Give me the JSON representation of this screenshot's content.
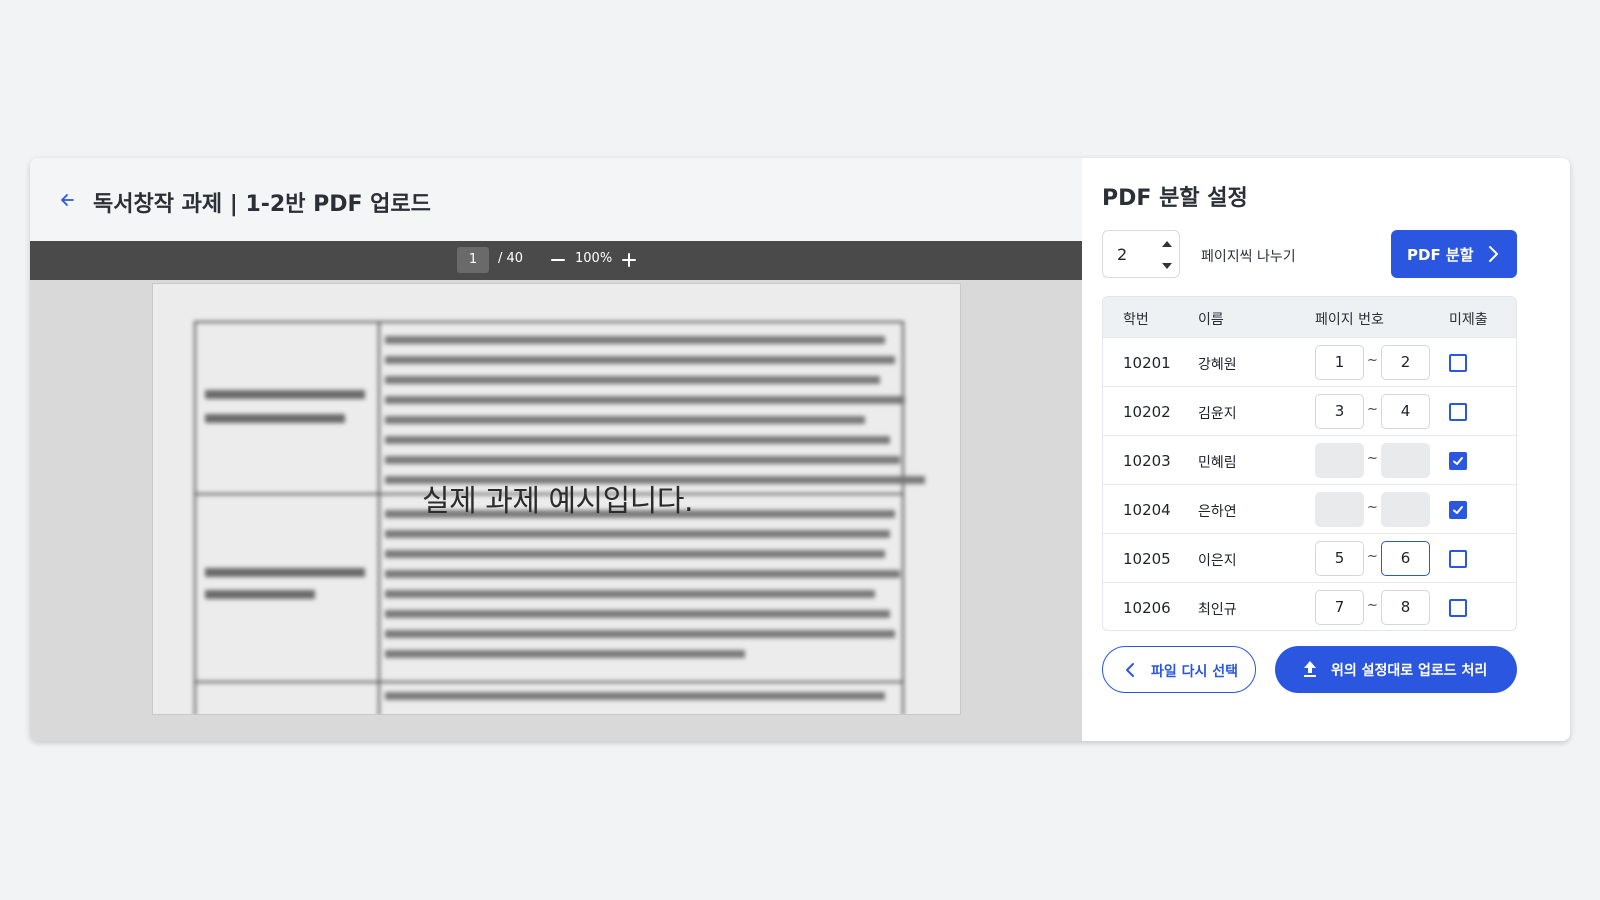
{
  "header": {
    "title": "독서창작 과제 | 1-2반 PDF 업로드"
  },
  "viewer": {
    "current_page": "1",
    "total_pages": "/ 40",
    "zoom": "100%",
    "overlay_text": "실제 과제 예시입니다."
  },
  "panel": {
    "title": "PDF 분할 설정",
    "pages_per_split": "2",
    "pages_per_split_label": "페이지씩 나누기",
    "split_button": "PDF 분할",
    "columns": {
      "student_id": "학번",
      "name": "이름",
      "page_range": "페이지 번호",
      "not_submitted": "미제출"
    },
    "range_separator": "~",
    "rows": [
      {
        "id": "10201",
        "name": "강혜원",
        "from": "1",
        "to": "2",
        "not_submitted": false
      },
      {
        "id": "10202",
        "name": "김윤지",
        "from": "3",
        "to": "4",
        "not_submitted": false
      },
      {
        "id": "10203",
        "name": "민혜림",
        "from": "",
        "to": "",
        "not_submitted": true
      },
      {
        "id": "10204",
        "name": "은하연",
        "from": "",
        "to": "",
        "not_submitted": true
      },
      {
        "id": "10205",
        "name": "이은지",
        "from": "5",
        "to": "6",
        "not_submitted": false
      },
      {
        "id": "10206",
        "name": "최인규",
        "from": "7",
        "to": "8",
        "not_submitted": false
      }
    ],
    "reselect_button": "파일 다시 선택",
    "upload_button": "위의 설정대로 업로드 처리"
  },
  "colors": {
    "accent": "#2b57e0",
    "toolbar": "#4a4a4a",
    "background": "#f2f3f5"
  },
  "icons": {
    "back": "arrow-left-icon",
    "zoom_out": "minus-icon",
    "zoom_in": "plus-icon",
    "split": "chevron-right-icon",
    "reselect": "chevron-left-icon",
    "upload": "upload-icon",
    "checkbox_checked": "checkmark-icon"
  }
}
